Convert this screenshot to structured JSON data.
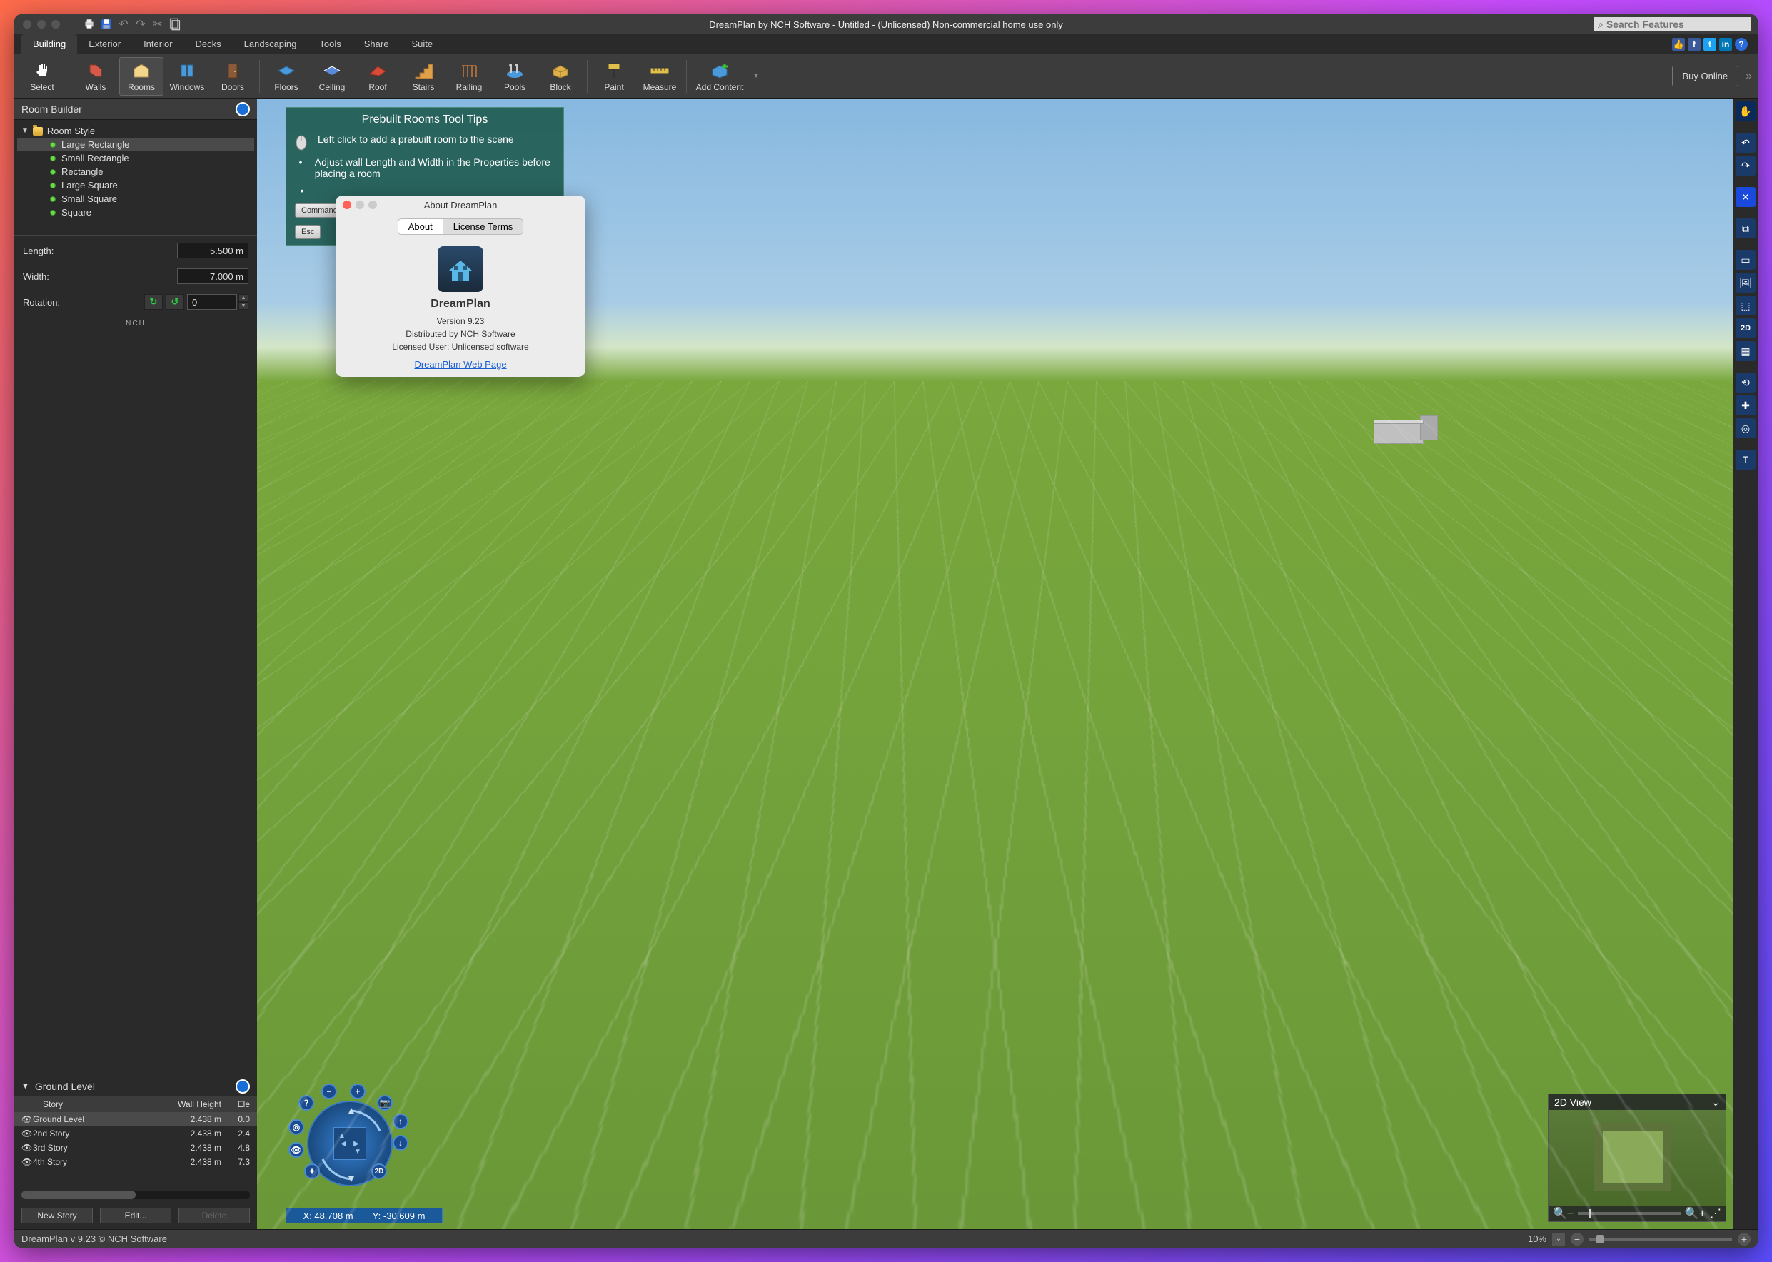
{
  "titlebar": {
    "title": "DreamPlan by NCH Software - Untitled - (Unlicensed) Non-commercial home use only",
    "search_placeholder": "Search Features"
  },
  "menu_tabs": [
    "Building",
    "Exterior",
    "Interior",
    "Decks",
    "Landscaping",
    "Tools",
    "Share",
    "Suite"
  ],
  "menu_active": "Building",
  "ribbon": {
    "items": [
      "Select",
      "Walls",
      "Rooms",
      "Windows",
      "Doors",
      "Floors",
      "Ceiling",
      "Roof",
      "Stairs",
      "Railing",
      "Pools",
      "Block",
      "Paint",
      "Measure",
      "Add Content"
    ],
    "active": "Rooms",
    "buy_online": "Buy Online"
  },
  "room_builder": {
    "title": "Room Builder",
    "folder": "Room Style",
    "styles": [
      "Large Rectangle",
      "Small Rectangle",
      "Rectangle",
      "Large Square",
      "Small Square",
      "Square"
    ],
    "selected_style": "Large Rectangle",
    "length_label": "Length:",
    "length_value": "5.500 m",
    "width_label": "Width:",
    "width_value": "7.000 m",
    "rotation_label": "Rotation:",
    "rotation_value": "0",
    "nch": "NCH"
  },
  "stories": {
    "title": "Ground Level",
    "headers": {
      "story": "Story",
      "wall_height": "Wall Height",
      "elevation": "Ele"
    },
    "rows": [
      {
        "name": "Ground Level",
        "wall_height": "2.438 m",
        "elevation": "0.0"
      },
      {
        "name": "2nd Story",
        "wall_height": "2.438 m",
        "elevation": "2.4"
      },
      {
        "name": "3rd Story",
        "wall_height": "2.438 m",
        "elevation": "4.8"
      },
      {
        "name": "4th Story",
        "wall_height": "2.438 m",
        "elevation": "7.3"
      }
    ],
    "selected_row": 0,
    "buttons": {
      "new": "New Story",
      "edit": "Edit...",
      "delete": "Delete"
    }
  },
  "tooltip": {
    "title": "Prebuilt Rooms Tool Tips",
    "line1": "Left click to add a prebuilt room to the scene",
    "line2": "Adjust wall Length and Width in the Properties before placing a room",
    "key_command": "Command",
    "key_esc": "Esc"
  },
  "about": {
    "window_title": "About DreamPlan",
    "tab_about": "About",
    "tab_license": "License Terms",
    "app_name": "DreamPlan",
    "version": "Version 9.23",
    "distributed": "Distributed by NCH Software",
    "licensed": "Licensed User: Unlicensed software",
    "link": "DreamPlan Web Page"
  },
  "coords": {
    "x": "X: 48.708 m",
    "y": "Y: -30.609 m"
  },
  "view2d": {
    "title": "2D View"
  },
  "status": {
    "text": "DreamPlan v 9.23 © NCH Software",
    "zoom": "10%"
  }
}
